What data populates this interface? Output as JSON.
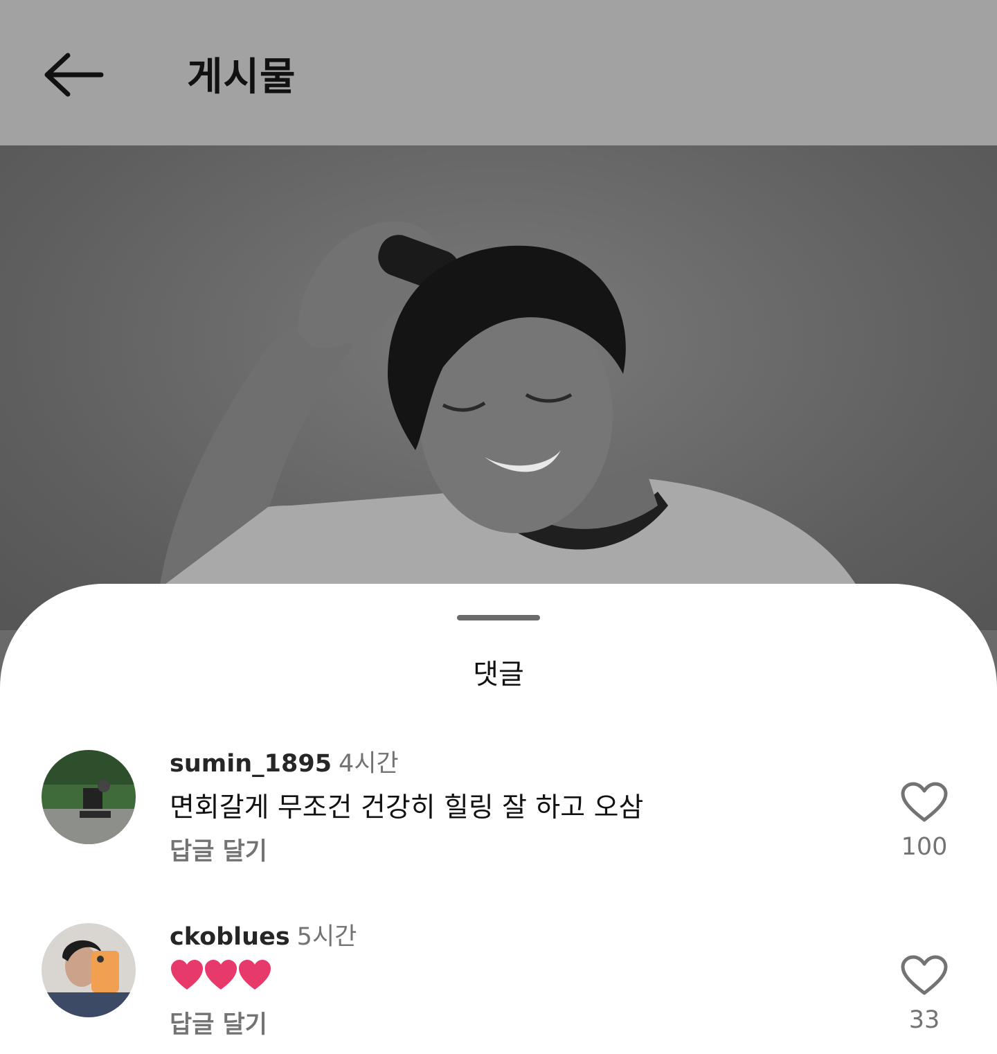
{
  "header": {
    "title": "게시물",
    "back_icon": "arrow-left-icon"
  },
  "post": {
    "image": "photo of a person trimming hair with clippers"
  },
  "comments_sheet": {
    "title": "댓글",
    "comments": [
      {
        "username": "sumin_1895",
        "time": "4시간",
        "text": "면회갈게 무조건 건강히 힐링 잘 하고 오삼",
        "reply_label": "답글 달기",
        "like_count": "100"
      },
      {
        "username": "ckoblues",
        "time": "5시간",
        "text": "",
        "emoji": "heart-emoji x3",
        "reply_label": "답글 달기",
        "like_count": "33"
      }
    ]
  },
  "colors": {
    "overlay_header": "#a2a2a2",
    "muted_text": "#737373",
    "heart_emoji": "#e83a6a"
  }
}
